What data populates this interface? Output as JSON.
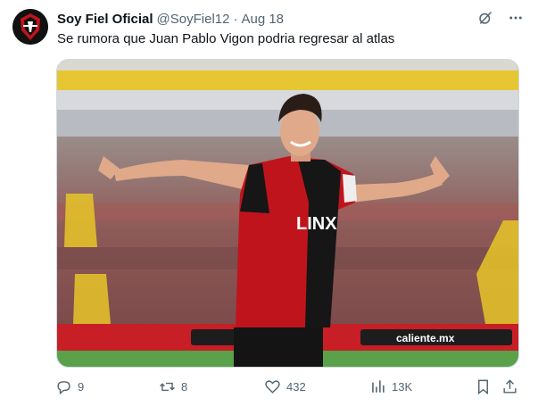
{
  "author": {
    "name": "Soy Fiel Oficial",
    "handle": "@SoyFiel12",
    "separator": "·",
    "date": "Aug 18"
  },
  "tweet": {
    "text": "Se rumora que Juan Pablo Vigon podria regresar al atlas"
  },
  "media": {
    "jersey_text": "LINX",
    "ad_text": "caliente.mx"
  },
  "actions": {
    "replies": "9",
    "retweets": "8",
    "likes": "432",
    "views": "13K"
  },
  "colors": {
    "text_primary": "#0f1419",
    "text_secondary": "#536471",
    "jersey_red": "#c0141c",
    "jersey_black": "#161616"
  }
}
